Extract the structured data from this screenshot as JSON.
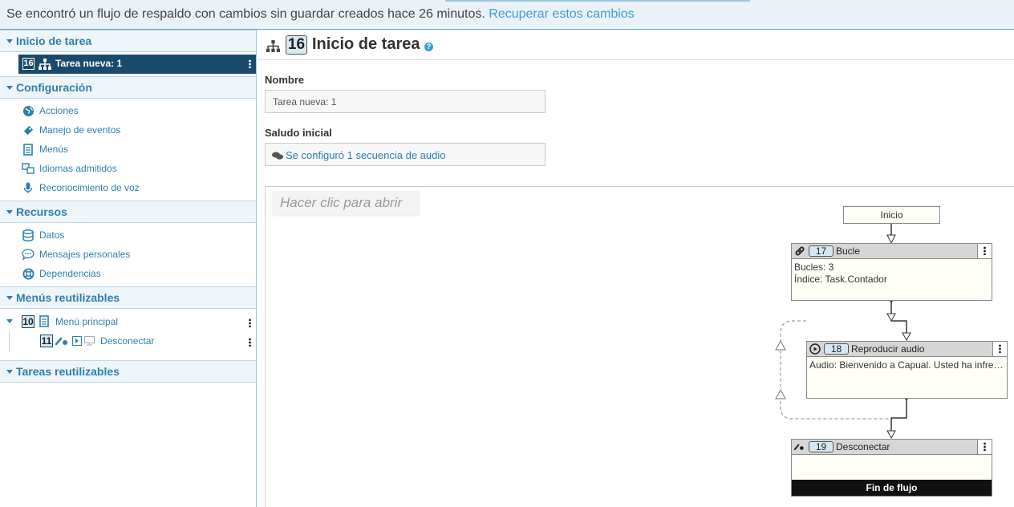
{
  "banner": {
    "message": "Se encontró un flujo de respaldo con cambios sin guardar creados hace 26 minutos.",
    "link": "Recuperar estos cambios"
  },
  "sidebar": {
    "sections": {
      "task_start": "Inicio de tarea",
      "config": "Configuración",
      "resources": "Recursos",
      "reusable_menus": "Menús reutilizables",
      "reusable_tasks": "Tareas reutilizables"
    },
    "task": {
      "id": "16",
      "label": "Tarea nueva: 1"
    },
    "config_items": [
      "Acciones",
      "Manejo de eventos",
      "Menús",
      "Idiomas admitidos",
      "Reconocimiento de voz"
    ],
    "resource_items": [
      "Datos",
      "Mensajes personales",
      "Dependencias"
    ],
    "menu": {
      "id": "10",
      "label": "Menú principal",
      "child_id": "11",
      "child_label": "Desconectar"
    }
  },
  "main": {
    "badge": "16",
    "title": "Inicio de tarea",
    "name_label": "Nombre",
    "name_value": "Tarea nueva: 1",
    "greeting_label": "Saludo inicial",
    "greeting_value": "Se configuró 1 secuencia de audio",
    "hint": "Hacer clic para abrir"
  },
  "flow": {
    "start": "Inicio",
    "loop": {
      "id": "17",
      "label": "Bucle",
      "line1": "Bucles: 3",
      "line2": "Índice: Task.Contador"
    },
    "play": {
      "id": "18",
      "label": "Reproducir audio",
      "line1": "Audio: Bienvenido a Capual. Usted ha infre…"
    },
    "disc": {
      "id": "19",
      "label": "Desconectar",
      "footer": "Fin de flujo"
    }
  },
  "colors": {
    "accent": "#2f7fae",
    "selected": "#1a4a6b",
    "link": "#3a9fd0"
  }
}
